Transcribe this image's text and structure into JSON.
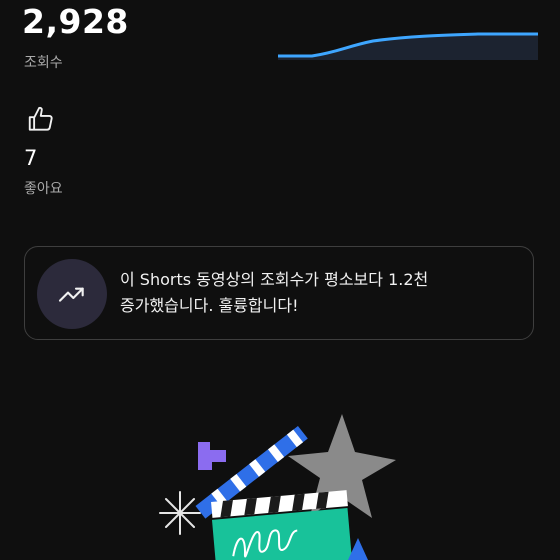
{
  "stats": {
    "views_count": "2,928",
    "views_label": "조회수",
    "likes_count": "7",
    "likes_label": "좋아요"
  },
  "insight": {
    "line1": "이 Shorts 동영상의 조회수가 평소보다 1.2천",
    "line2": "증가했습니다. 훌륭합니다!"
  },
  "icons": {
    "like": "thumbs-up-icon",
    "trend": "trending-up-icon"
  },
  "colors": {
    "background": "#0f0f0f",
    "sparkline": "#3ea6ff",
    "card_border": "#3e3e3e",
    "trend_circle": "#2c2a3b"
  }
}
